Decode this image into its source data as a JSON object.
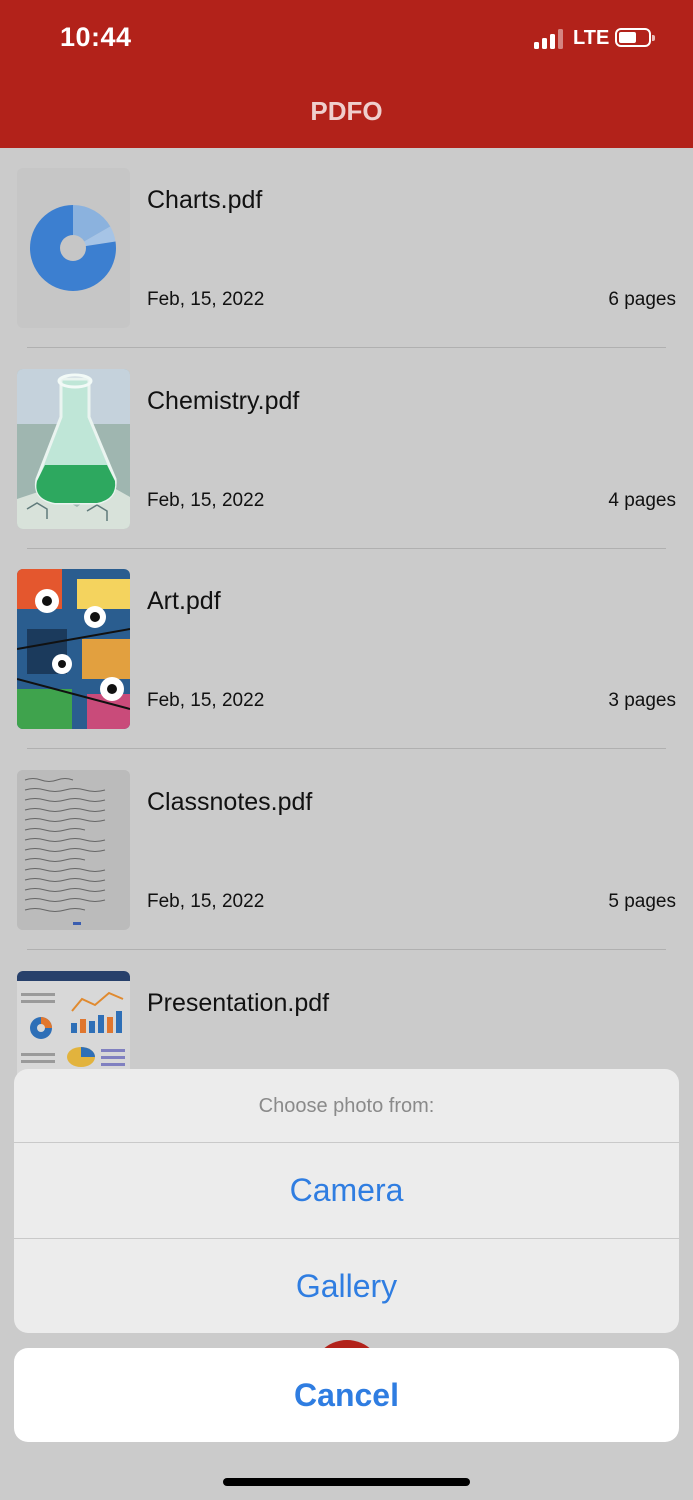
{
  "status": {
    "time": "10:44",
    "network": "LTE",
    "signal_bars_active": 3,
    "signal_bars_total": 4,
    "battery_level": 0.5
  },
  "app": {
    "title": "PDFO",
    "brand_color": "#b2221a"
  },
  "files": [
    {
      "name": "Charts.pdf",
      "date": "Feb, 15, 2022",
      "pages": "6 pages",
      "thumbnail": "pie-chart-thumbnail"
    },
    {
      "name": "Chemistry.pdf",
      "date": "Feb, 15, 2022",
      "pages": "4 pages",
      "thumbnail": "chemistry-flask-thumbnail"
    },
    {
      "name": "Art.pdf",
      "date": "Feb, 15, 2022",
      "pages": "3 pages",
      "thumbnail": "graffiti-art-thumbnail"
    },
    {
      "name": "Classnotes.pdf",
      "date": "Feb, 15, 2022",
      "pages": "5 pages",
      "thumbnail": "handwritten-notes-thumbnail"
    },
    {
      "name": "Presentation.pdf",
      "thumbnail": "presentation-slide-thumbnail"
    }
  ],
  "action_sheet": {
    "title": "Choose photo from:",
    "options": [
      {
        "label": "Camera"
      },
      {
        "label": "Gallery"
      }
    ],
    "cancel_label": "Cancel",
    "accent_color": "#2f7de1"
  }
}
